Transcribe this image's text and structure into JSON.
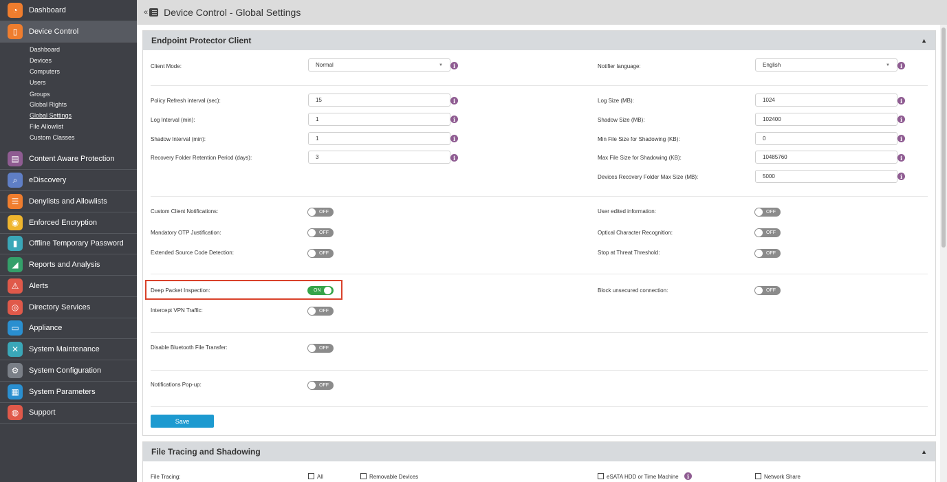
{
  "sidebar": {
    "items": [
      {
        "label": "Dashboard",
        "icon": "dashboard-icon",
        "color": "#ef7d2e"
      },
      {
        "label": "Device Control",
        "icon": "usb-icon",
        "color": "#ef7d2e"
      },
      {
        "label": "Content Aware Protection",
        "icon": "document-search-icon",
        "color": "#8f5c92"
      },
      {
        "label": "eDiscovery",
        "icon": "telescope-icon",
        "color": "#5f7ec5"
      },
      {
        "label": "Denylists and Allowlists",
        "icon": "list-icon",
        "color": "#ef7d2e"
      },
      {
        "label": "Enforced Encryption",
        "icon": "lock-icon",
        "color": "#efb52e"
      },
      {
        "label": "Offline Temporary Password",
        "icon": "password-icon",
        "color": "#3aa7b8"
      },
      {
        "label": "Reports and Analysis",
        "icon": "chart-icon",
        "color": "#34a06a"
      },
      {
        "label": "Alerts",
        "icon": "alert-icon",
        "color": "#e0594a"
      },
      {
        "label": "Directory Services",
        "icon": "directory-icon",
        "color": "#e0594a"
      },
      {
        "label": "Appliance",
        "icon": "appliance-icon",
        "color": "#2a8fd0"
      },
      {
        "label": "System Maintenance",
        "icon": "tools-icon",
        "color": "#3aa7b8"
      },
      {
        "label": "System Configuration",
        "icon": "gear-icon",
        "color": "#7a7f87"
      },
      {
        "label": "System Parameters",
        "icon": "parameters-icon",
        "color": "#2a8fd0"
      },
      {
        "label": "Support",
        "icon": "support-icon",
        "color": "#e0594a"
      }
    ],
    "subitems": [
      "Dashboard",
      "Devices",
      "Computers",
      "Users",
      "Groups",
      "Global Rights",
      "Global Settings",
      "File Allowlist",
      "Custom Classes"
    ]
  },
  "header": {
    "collapse": "«",
    "title": "Device Control - Global Settings"
  },
  "panel1": {
    "title": "Endpoint Protector Client",
    "client_mode": {
      "label": "Client Mode:",
      "value": "Normal"
    },
    "notifier_language": {
      "label": "Notifier language:",
      "value": "English"
    },
    "left_fields": [
      {
        "label": "Policy Refresh interval (sec):",
        "value": "15"
      },
      {
        "label": "Log Interval (min):",
        "value": "1"
      },
      {
        "label": "Shadow Interval (min):",
        "value": "1"
      },
      {
        "label": "Recovery Folder Retention Period (days):",
        "value": "3"
      }
    ],
    "right_fields": [
      {
        "label": "Log Size (MB):",
        "value": "1024"
      },
      {
        "label": "Shadow Size (MB):",
        "value": "102400"
      },
      {
        "label": "Min File Size for Shadowing (KB):",
        "value": "0"
      },
      {
        "label": "Max File Size for Shadowing (KB):",
        "value": "10485760"
      },
      {
        "label": "Devices Recovery Folder Max Size (MB):",
        "value": "5000"
      }
    ],
    "toggles_left": [
      {
        "label": "Custom Client Notifications:",
        "state": "OFF"
      },
      {
        "label": "Mandatory OTP Justification:",
        "state": "OFF"
      },
      {
        "label": "Extended Source Code Detection:",
        "state": "OFF"
      },
      {
        "label": "Deep Packet Inspection:",
        "state": "ON"
      },
      {
        "label": "Intercept VPN Traffic:",
        "state": "OFF"
      },
      {
        "label": "Disable Bluetooth File Transfer:",
        "state": "OFF"
      },
      {
        "label": "Notifications Pop-up:",
        "state": "OFF"
      }
    ],
    "toggles_right": [
      {
        "label": "User edited information:",
        "state": "OFF"
      },
      {
        "label": "Optical Character Recognition:",
        "state": "OFF"
      },
      {
        "label": "Stop at Threat Threshold:",
        "state": "OFF"
      },
      {
        "label": "Block unsecured connection:",
        "state": "OFF"
      }
    ],
    "save_label": "Save"
  },
  "panel2": {
    "title": "File Tracing and Shadowing",
    "file_tracing_label": "File Tracing:",
    "options": [
      "All",
      "Removable Devices",
      "eSATA HDD or Time Machine",
      "Network Share"
    ]
  },
  "colors": {
    "sidebar_bg": "#3e4046",
    "toggle_on": "#35a449",
    "toggle_off": "#8b8b8b",
    "save_button": "#1d9ad0",
    "info_icon": "#8f5c92",
    "highlight": "#d9412a"
  }
}
